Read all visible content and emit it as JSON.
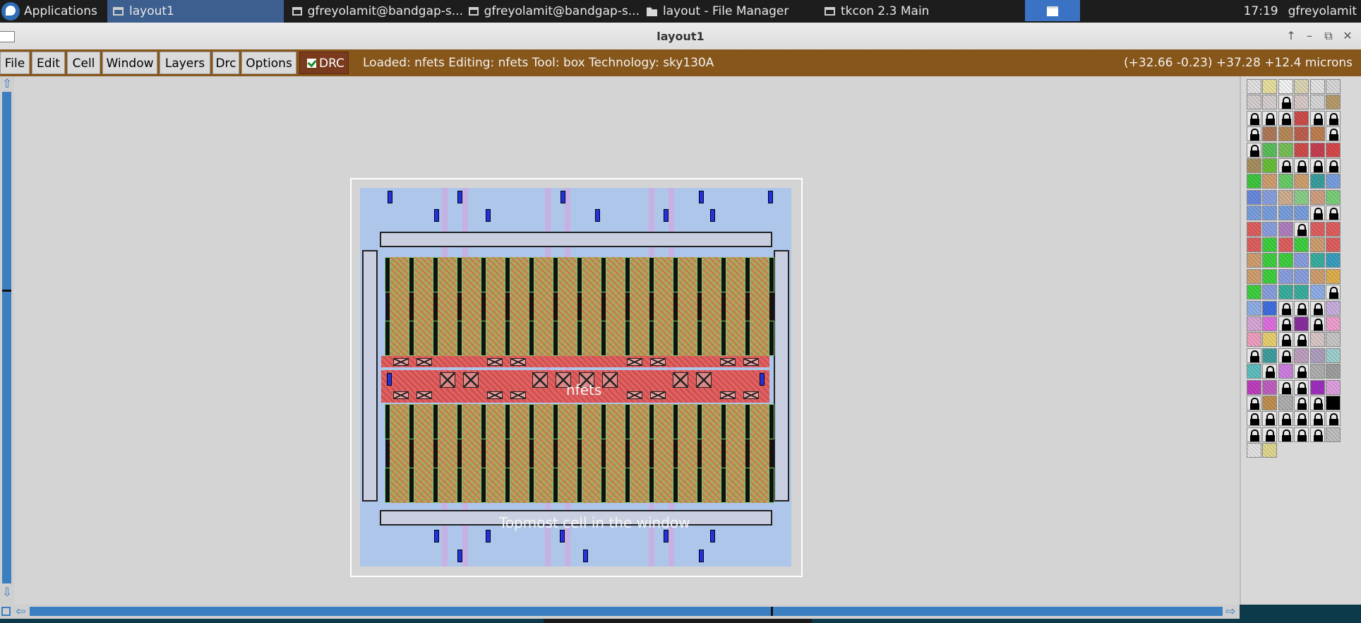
{
  "taskbar": {
    "applications_label": "Applications",
    "tasks": [
      {
        "label": "layout1",
        "icon": "window-icon"
      },
      {
        "label": "gfreyolamit@bandgap-s...",
        "icon": "terminal-icon"
      },
      {
        "label": "gfreyolamit@bandgap-s...",
        "icon": "terminal-icon"
      },
      {
        "label": "layout - File Manager",
        "icon": "folder-icon"
      },
      {
        "label": "tkcon 2.3 Main",
        "icon": "window-icon"
      }
    ],
    "clock": "17:19",
    "user": "gfreyolamit"
  },
  "window": {
    "title": "layout1",
    "controls": [
      "↑",
      "–",
      "⧉",
      "✕"
    ]
  },
  "menubar": {
    "items": [
      "File",
      "Edit",
      "Cell",
      "Window",
      "Layers",
      "Drc",
      "Options"
    ],
    "drc_toggle_label": "DRC",
    "drc_checked": true,
    "status": "Loaded: nfets Editing: nfets Tool: box  Technology: sky130A",
    "coordinates": "(+32.66 -0.23) +37.28 +12.4 microns",
    "accent_color": "#87561a"
  },
  "canvas": {
    "cell_name": "nfets",
    "cell_description": "Topmost cell in the window"
  },
  "scrollbars": {
    "up_arrow": "⇧",
    "down_arrow": "⇩",
    "left_arrow": "⇦",
    "right_arrow": "⇨"
  },
  "palette": {
    "rows": [
      [
        "#e2e2e2",
        "#e8e0a0",
        "#f4f4f4",
        "#dcd6b4",
        "#e4e4e4",
        "#d8d8d8"
      ],
      [
        "#d6cfcf",
        "#d8d0d0",
        "lock",
        "#dacaca",
        "#d8d8d8",
        "#b89c6c"
      ],
      [
        "lock",
        "lock",
        "lock",
        "#cf4d4d",
        "lock",
        "lock"
      ],
      [
        "lock",
        "#b07a5a",
        "#b88a5a",
        "#c06050",
        "#c08050",
        "lock"
      ],
      [
        "lock",
        "#5cbf5c",
        "#7ac05a",
        "#cf4d4d",
        "#c84050",
        "#d84a4a"
      ],
      [
        "#a89060",
        "#6abf3a",
        "lock",
        "lock",
        "lock",
        "lock"
      ],
      [
        "#40c840",
        "#d0a070",
        "#6ace6a",
        "#d0a070",
        "#3aa0a0",
        "#7aa0e0"
      ],
      [
        "#6a8ae0",
        "#8aa0e0",
        "#d0b090",
        "#8ad08a",
        "#d0a080",
        "#7ad07a"
      ],
      [
        "#7aa0e0",
        "#7aa0e0",
        "#7aa0e0",
        "#7aa0e0",
        "lock",
        "lock"
      ],
      [
        "#e06060",
        "#8aa0e0",
        "#b080c0",
        "lock",
        "#e06060",
        "#e06060"
      ],
      [
        "#e06060",
        "#40d040",
        "#e06060",
        "#40d040",
        "#d0a070",
        "#e06060"
      ],
      [
        "#d0a070",
        "#40d040",
        "#40d040",
        "#8aa0e0",
        "#3ab0a0",
        "#3aa0c0"
      ],
      [
        "#d0a070",
        "#40d040",
        "#8aa0e0",
        "#8aa0e0",
        "#d0a070",
        "#e0b050"
      ],
      [
        "#40d040",
        "#8aa0e0",
        "#3ab0a0",
        "#3ab0a0",
        "#90b0e8",
        "lock"
      ],
      [
        "#90b0e8",
        "#4070e0",
        "lock",
        "lock",
        "lock",
        "#c8b0e0"
      ],
      [
        "#d8a8d8",
        "#e070e0",
        "lock",
        "#8a30a0",
        "lock",
        "#f0a0d0"
      ],
      [
        "#f0a0c0",
        "#e8d070",
        "lock",
        "lock",
        "#d8c8c8",
        "#c8c8c8"
      ],
      [
        "lock",
        "#40a0a0",
        "lock",
        "#c0a0c0",
        "#b0a0c0",
        "#a0d0d0"
      ],
      [
        "#60c0c0",
        "lock",
        "#d080e0",
        "lock",
        "#b0b0b0",
        "#a0a0a0"
      ],
      [
        "#c040c0",
        "#c060c0",
        "lock",
        "lock",
        "#a030c0",
        "#e0a0e0"
      ],
      [
        "lock",
        "#c09050",
        "#b0b0b0",
        "lock",
        "lock",
        "#000000"
      ],
      [
        "lock",
        "lock",
        "lock",
        "lock",
        "lock",
        "lock"
      ],
      [
        "lock",
        "lock",
        "lock",
        "lock",
        "lock",
        "#c0c0c0"
      ],
      [
        "#e4e4e4",
        "#e0d890"
      ]
    ]
  }
}
